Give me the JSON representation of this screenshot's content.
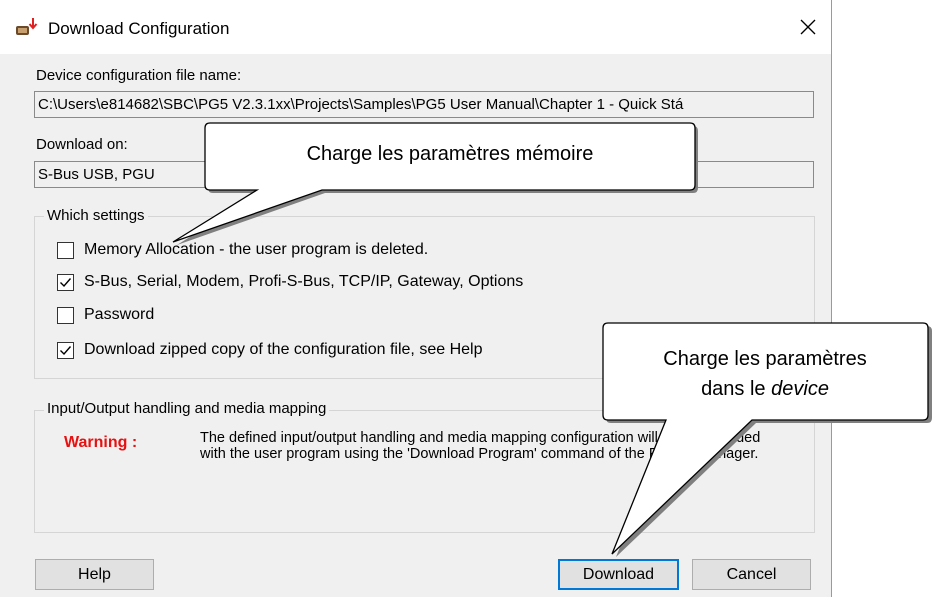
{
  "window": {
    "title": "Download Configuration"
  },
  "fields": {
    "file_label": "Device configuration file name:",
    "file_value": "C:\\Users\\e814682\\SBC\\PG5 V2.3.1xx\\Projects\\Samples\\PG5 User Manual\\Chapter 1 - Quick Stá",
    "download_on_label": "Download on:",
    "download_on_value": "S-Bus USB, PGU"
  },
  "settings": {
    "title": "Which settings",
    "items": [
      {
        "label": "Memory Allocation - the user program is deleted.",
        "checked": false
      },
      {
        "label": "S-Bus, Serial, Modem, Profi-S-Bus, TCP/IP, Gateway, Options",
        "checked": true
      },
      {
        "label": "Password",
        "checked": false
      },
      {
        "label": "Download zipped copy of the configuration file, see Help",
        "checked": true
      }
    ]
  },
  "io": {
    "title": "Input/Output handling and media mapping",
    "warning_label": "Warning :",
    "warning_text": "The defined input/output handling and media mapping configuration will be downloaded with the user program using the 'Download Program' command of the Project Manager."
  },
  "buttons": {
    "help": "Help",
    "download": "Download",
    "cancel": "Cancel"
  },
  "callouts": {
    "memory": "Charge les  paramètres mémoire",
    "device_line1": "Charge les paramètres",
    "device_line2_prefix": "dans le ",
    "device_line2_italic": "device"
  }
}
